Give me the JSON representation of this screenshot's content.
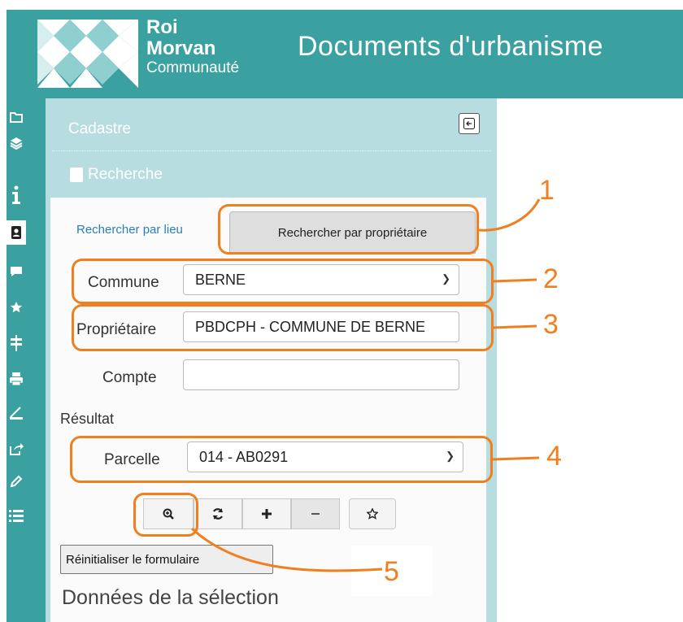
{
  "header": {
    "brand_line1": "Roi",
    "brand_line2": "Morvan",
    "brand_line3": "Communauté",
    "app_title": "Documents d'urbanisme",
    "band_color": "#3aa0a0"
  },
  "toolbar": {
    "items": [
      "folder-icon",
      "layers-icon",
      "info-icon",
      "address-book-icon",
      "comment-icon",
      "star-icon",
      "signpost-icon",
      "print-icon",
      "measure-icon",
      "share-icon",
      "pencil-icon",
      "list-icon"
    ],
    "active": "address-book-icon"
  },
  "panel": {
    "title": "Cadastre",
    "section": "Recherche",
    "tabs": {
      "by_place": "Rechercher par lieu",
      "by_owner": "Rechercher par propriétaire"
    },
    "commune_label": "Commune",
    "commune_value": "BERNE",
    "owner_label": "Propriétaire",
    "owner_value": "PBDCPH - COMMUNE DE BERNE",
    "account_label": "Compte",
    "account_value": "",
    "result_heading": "Résultat",
    "parcel_label": "Parcelle",
    "parcel_value": "014 - AB0291",
    "reset_label": "Réinitialiser le formulaire",
    "selection_heading": "Données de la sélection"
  },
  "annotations": {
    "color": "#f07f1f",
    "n1": "1",
    "n2": "2",
    "n3": "3",
    "n4": "4",
    "n5": "5"
  }
}
